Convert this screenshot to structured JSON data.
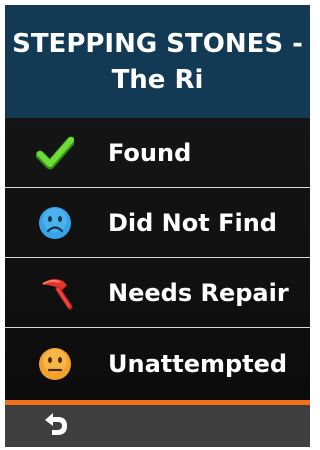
{
  "header": {
    "title": "STEPPING STONES - The Ri"
  },
  "options": [
    {
      "label": "Found",
      "icon": "checkmark-icon",
      "color": "#5fcf2c"
    },
    {
      "label": "Did Not Find",
      "icon": "sad-face-icon",
      "color": "#35a4e8"
    },
    {
      "label": "Needs Repair",
      "icon": "hammer-icon",
      "color": "#e8332b"
    },
    {
      "label": "Unattempted",
      "icon": "neutral-face-icon",
      "color": "#f2a22b"
    }
  ],
  "colors": {
    "header_bg": "#123a55",
    "accent": "#f06f1d",
    "footer_bg": "#3f3f3f"
  },
  "footer": {
    "back_icon": "back-arrow-icon"
  }
}
